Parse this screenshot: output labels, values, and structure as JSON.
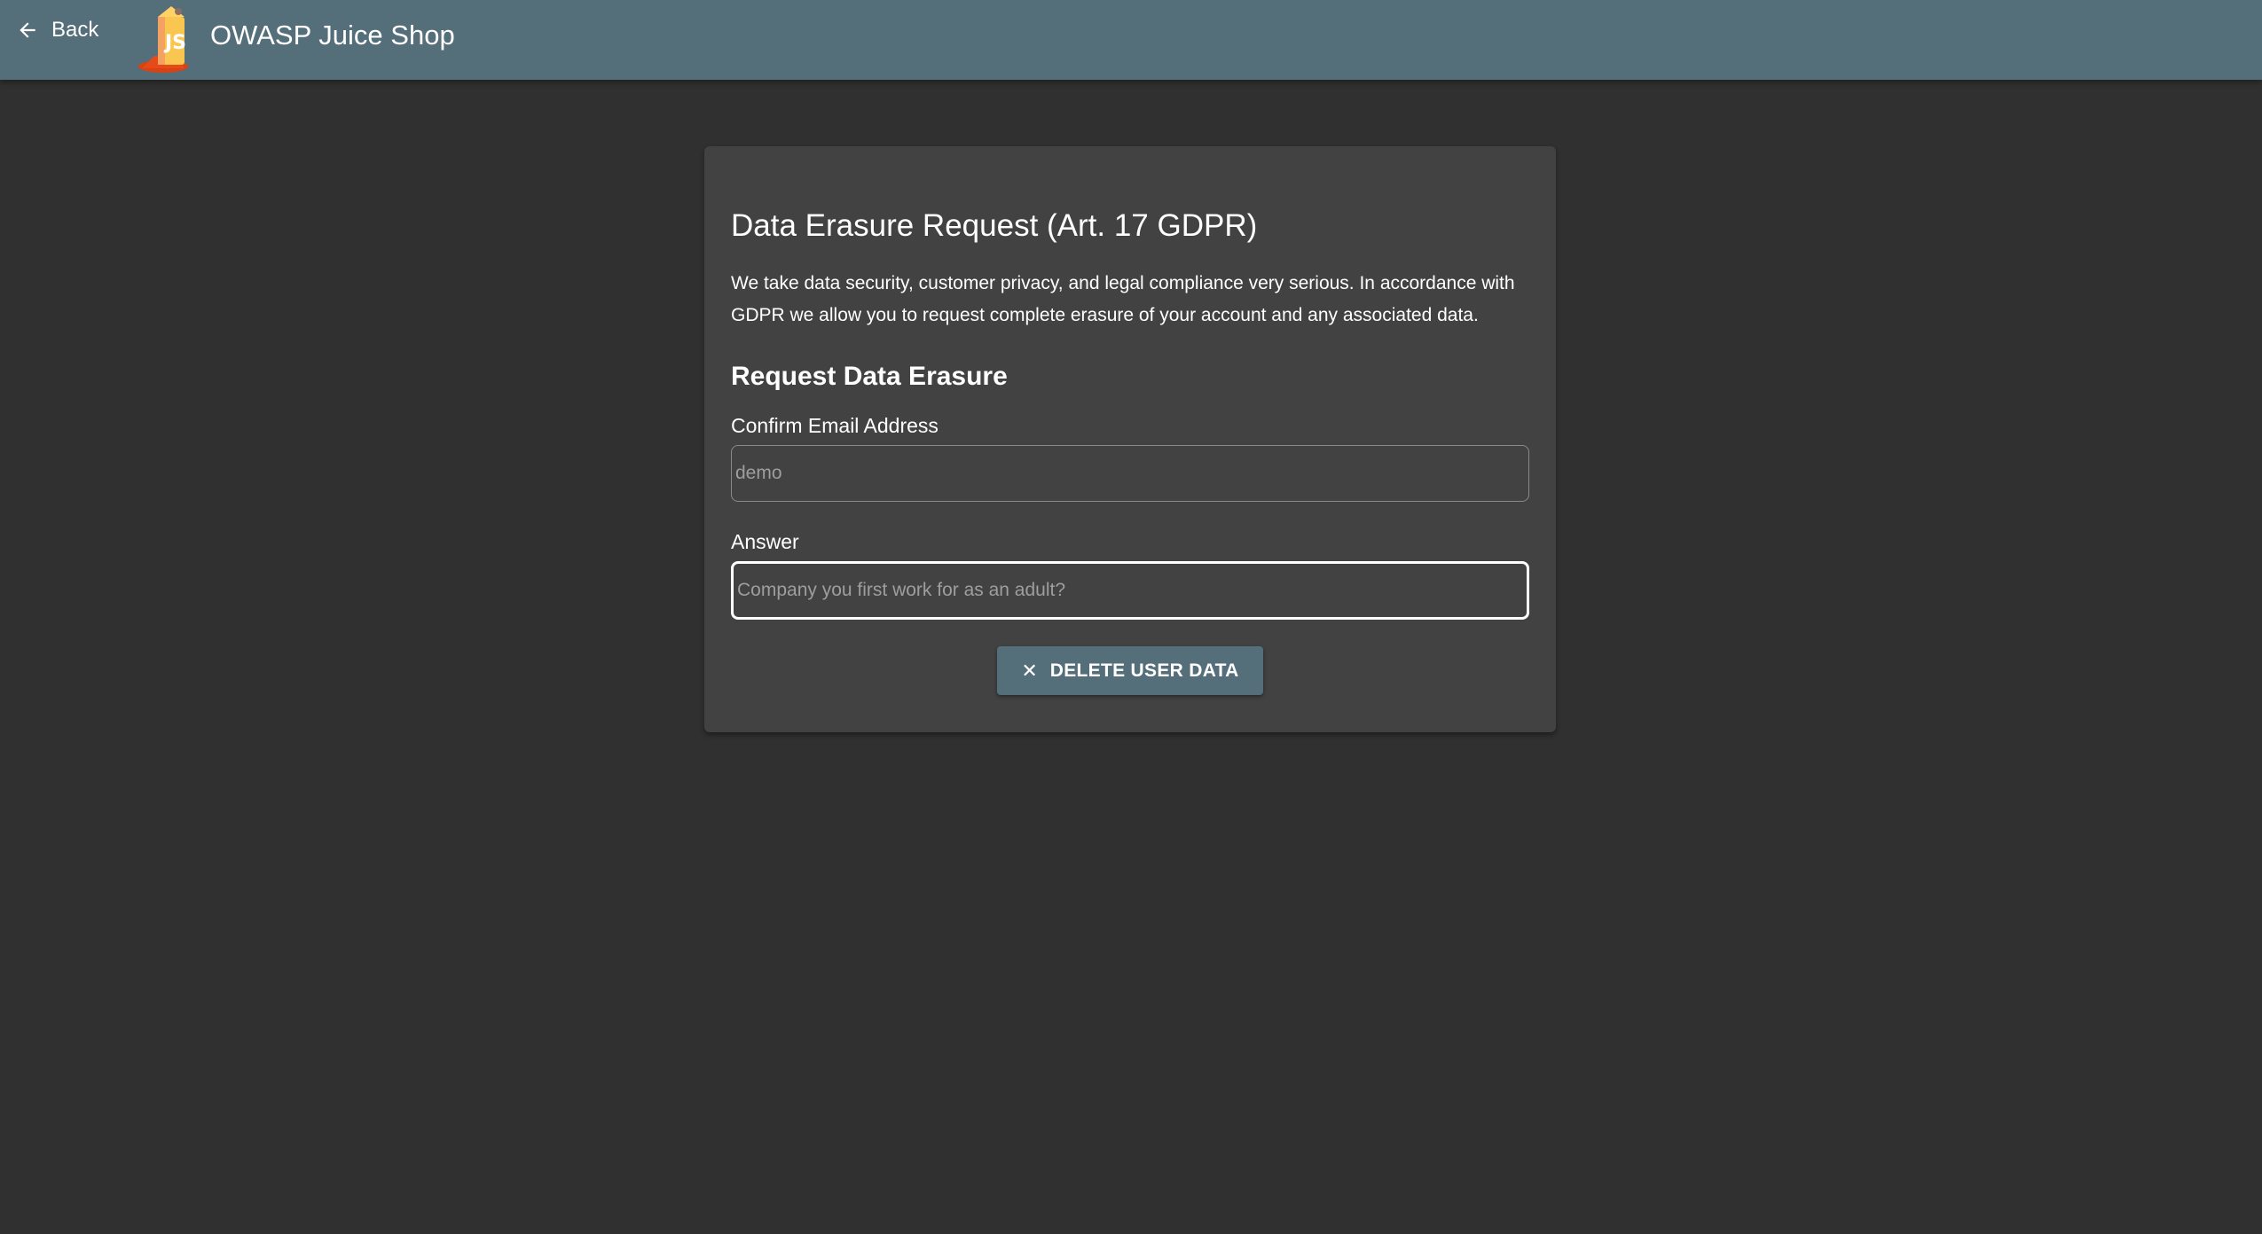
{
  "toolbar": {
    "back_label": "Back",
    "back_icon": "arrow-left-icon",
    "logo_icon": "juice-shop-logo",
    "app_title": "OWASP Juice Shop",
    "background_color": "#546e7a"
  },
  "form": {
    "title": "Data Erasure Request (Art. 17 GDPR)",
    "description": "We take data security, customer privacy, and legal compliance very serious. In accordance with GDPR we allow you to request complete erasure of your account and any associated data.",
    "section_title": "Request Data Erasure",
    "email": {
      "label": "Confirm Email Address",
      "placeholder": "demo",
      "value": ""
    },
    "answer": {
      "label": "Answer",
      "placeholder": "Company you first work for as an adult?",
      "value": ""
    },
    "delete_button": {
      "icon": "close-icon",
      "label": "DELETE USER DATA"
    }
  },
  "colors": {
    "page_background": "#303030",
    "card_background": "#424242",
    "accent": "#546e7a"
  }
}
